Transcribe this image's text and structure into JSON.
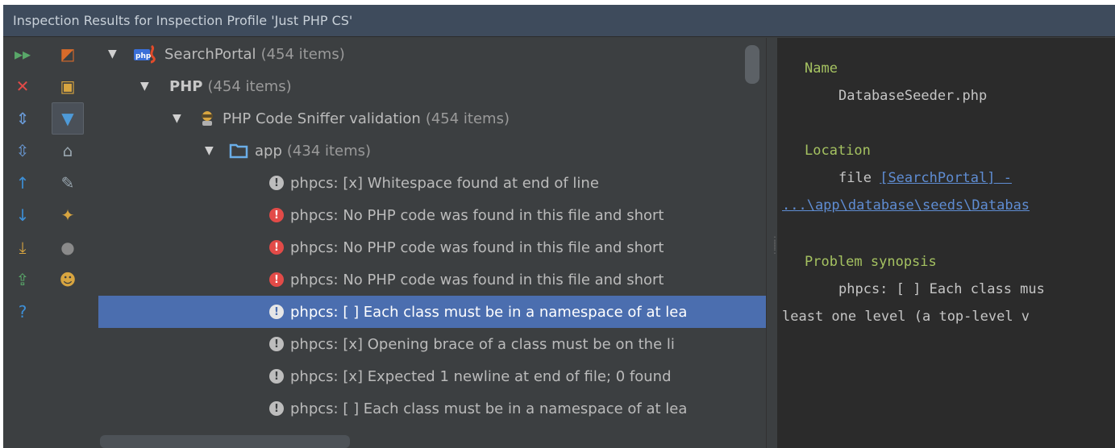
{
  "window": {
    "title": "Inspection Results for Inspection Profile 'Just PHP CS'"
  },
  "toolbar_left": [
    {
      "icon": "run-icon",
      "glyph": "▸▸",
      "color": "#59a869"
    },
    {
      "icon": "close-icon",
      "glyph": "✕",
      "color": "#e24b48"
    },
    {
      "icon": "expand-all-icon",
      "glyph": "⇕",
      "color": "#6a9bd8"
    },
    {
      "icon": "collapse-all-icon",
      "glyph": "⇳",
      "color": "#6a9bd8"
    },
    {
      "icon": "up-arrow-icon",
      "glyph": "↑",
      "color": "#3d8fd6"
    },
    {
      "icon": "down-arrow-icon",
      "glyph": "↓",
      "color": "#3d8fd6"
    },
    {
      "icon": "export-icon",
      "glyph": "⤓",
      "color": "#d8a540"
    },
    {
      "icon": "external-export-icon",
      "glyph": "⇪",
      "color": "#59a869"
    },
    {
      "icon": "help-icon",
      "glyph": "?",
      "color": "#3d8fd6"
    }
  ],
  "toolbar_right": [
    {
      "icon": "group-by-severity-icon",
      "glyph": "◩",
      "color": "#d86b2a"
    },
    {
      "icon": "group-by-directory-icon",
      "glyph": "▣",
      "color": "#d8a540"
    },
    {
      "icon": "filter-icon",
      "glyph": "▼",
      "color": "#4e9ad8"
    },
    {
      "icon": "toolbox-icon",
      "glyph": "⌂",
      "color": "#9aa7b0"
    },
    {
      "icon": "edit-settings-icon",
      "glyph": "✎",
      "color": "#9aa7b0"
    },
    {
      "icon": "wrench-icon",
      "glyph": "✦",
      "color": "#d8a540"
    },
    {
      "icon": "lightbulb-icon",
      "glyph": "●",
      "color": "#8a8a8a"
    },
    {
      "icon": "inspector-icon",
      "glyph": "☻",
      "color": "#d8a540"
    }
  ],
  "tree": {
    "project": {
      "label": "SearchPortal",
      "count": "(454 items)"
    },
    "language": {
      "label": "PHP",
      "count": "(454 items)"
    },
    "inspection": {
      "label": "PHP Code Sniffer validation",
      "count": "(454 items)"
    },
    "folder": {
      "label": "app",
      "count": "(434 items)"
    },
    "problems": [
      {
        "severity": "warning",
        "text": "phpcs: [x] Whitespace found at end of line"
      },
      {
        "severity": "error",
        "text": "phpcs: No PHP code was found in this file and short"
      },
      {
        "severity": "error",
        "text": "phpcs: No PHP code was found in this file and short"
      },
      {
        "severity": "error",
        "text": "phpcs: No PHP code was found in this file and short"
      },
      {
        "severity": "warning",
        "text": "phpcs: [ ] Each class must be in a namespace of at lea",
        "selected": true
      },
      {
        "severity": "warning",
        "text": "phpcs: [x] Opening brace of a class must be on the li"
      },
      {
        "severity": "warning",
        "text": "phpcs: [x] Expected 1 newline at end of file; 0 found"
      },
      {
        "severity": "warning",
        "text": "phpcs: [ ] Each class must be in a namespace of at lea"
      }
    ]
  },
  "details": {
    "name_label": "Name",
    "name_value": "DatabaseSeeder.php",
    "location_label": "Location",
    "location_prefix": "file",
    "location_link_1": "[SearchPortal] -",
    "location_link_2": "...\\app\\database\\seeds\\Databas",
    "synopsis_label": "Problem synopsis",
    "synopsis_line_1": "phpcs: [ ] Each class mus",
    "synopsis_line_2": "least one level (a top-level v"
  }
}
